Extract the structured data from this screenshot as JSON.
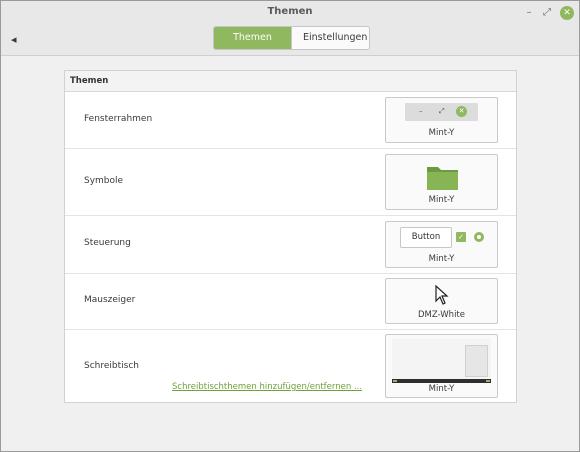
{
  "window": {
    "title": "Themen",
    "minimize_glyph": "–",
    "restore_glyph": "⤢",
    "close_glyph": "✕"
  },
  "toolbar": {
    "back_glyph": "◂",
    "tabs": [
      {
        "label": "Themen",
        "active": true
      },
      {
        "label": "Einstellungen",
        "active": false
      }
    ]
  },
  "panel": {
    "header": "Themen",
    "rows": [
      {
        "label": "Fensterrahmen",
        "value": "Mint-Y"
      },
      {
        "label": "Symbole",
        "value": "Mint-Y"
      },
      {
        "label": "Steuerung",
        "value": "Mint-Y",
        "preview_button": "Button"
      },
      {
        "label": "Mauszeiger",
        "value": "DMZ-White"
      },
      {
        "label": "Schreibtisch",
        "value": "Mint-Y"
      }
    ],
    "link": "Schreibtischthemen hinzufügen/entfernen ..."
  },
  "colors": {
    "accent": "#8fb85f",
    "link": "#6ea13a"
  }
}
